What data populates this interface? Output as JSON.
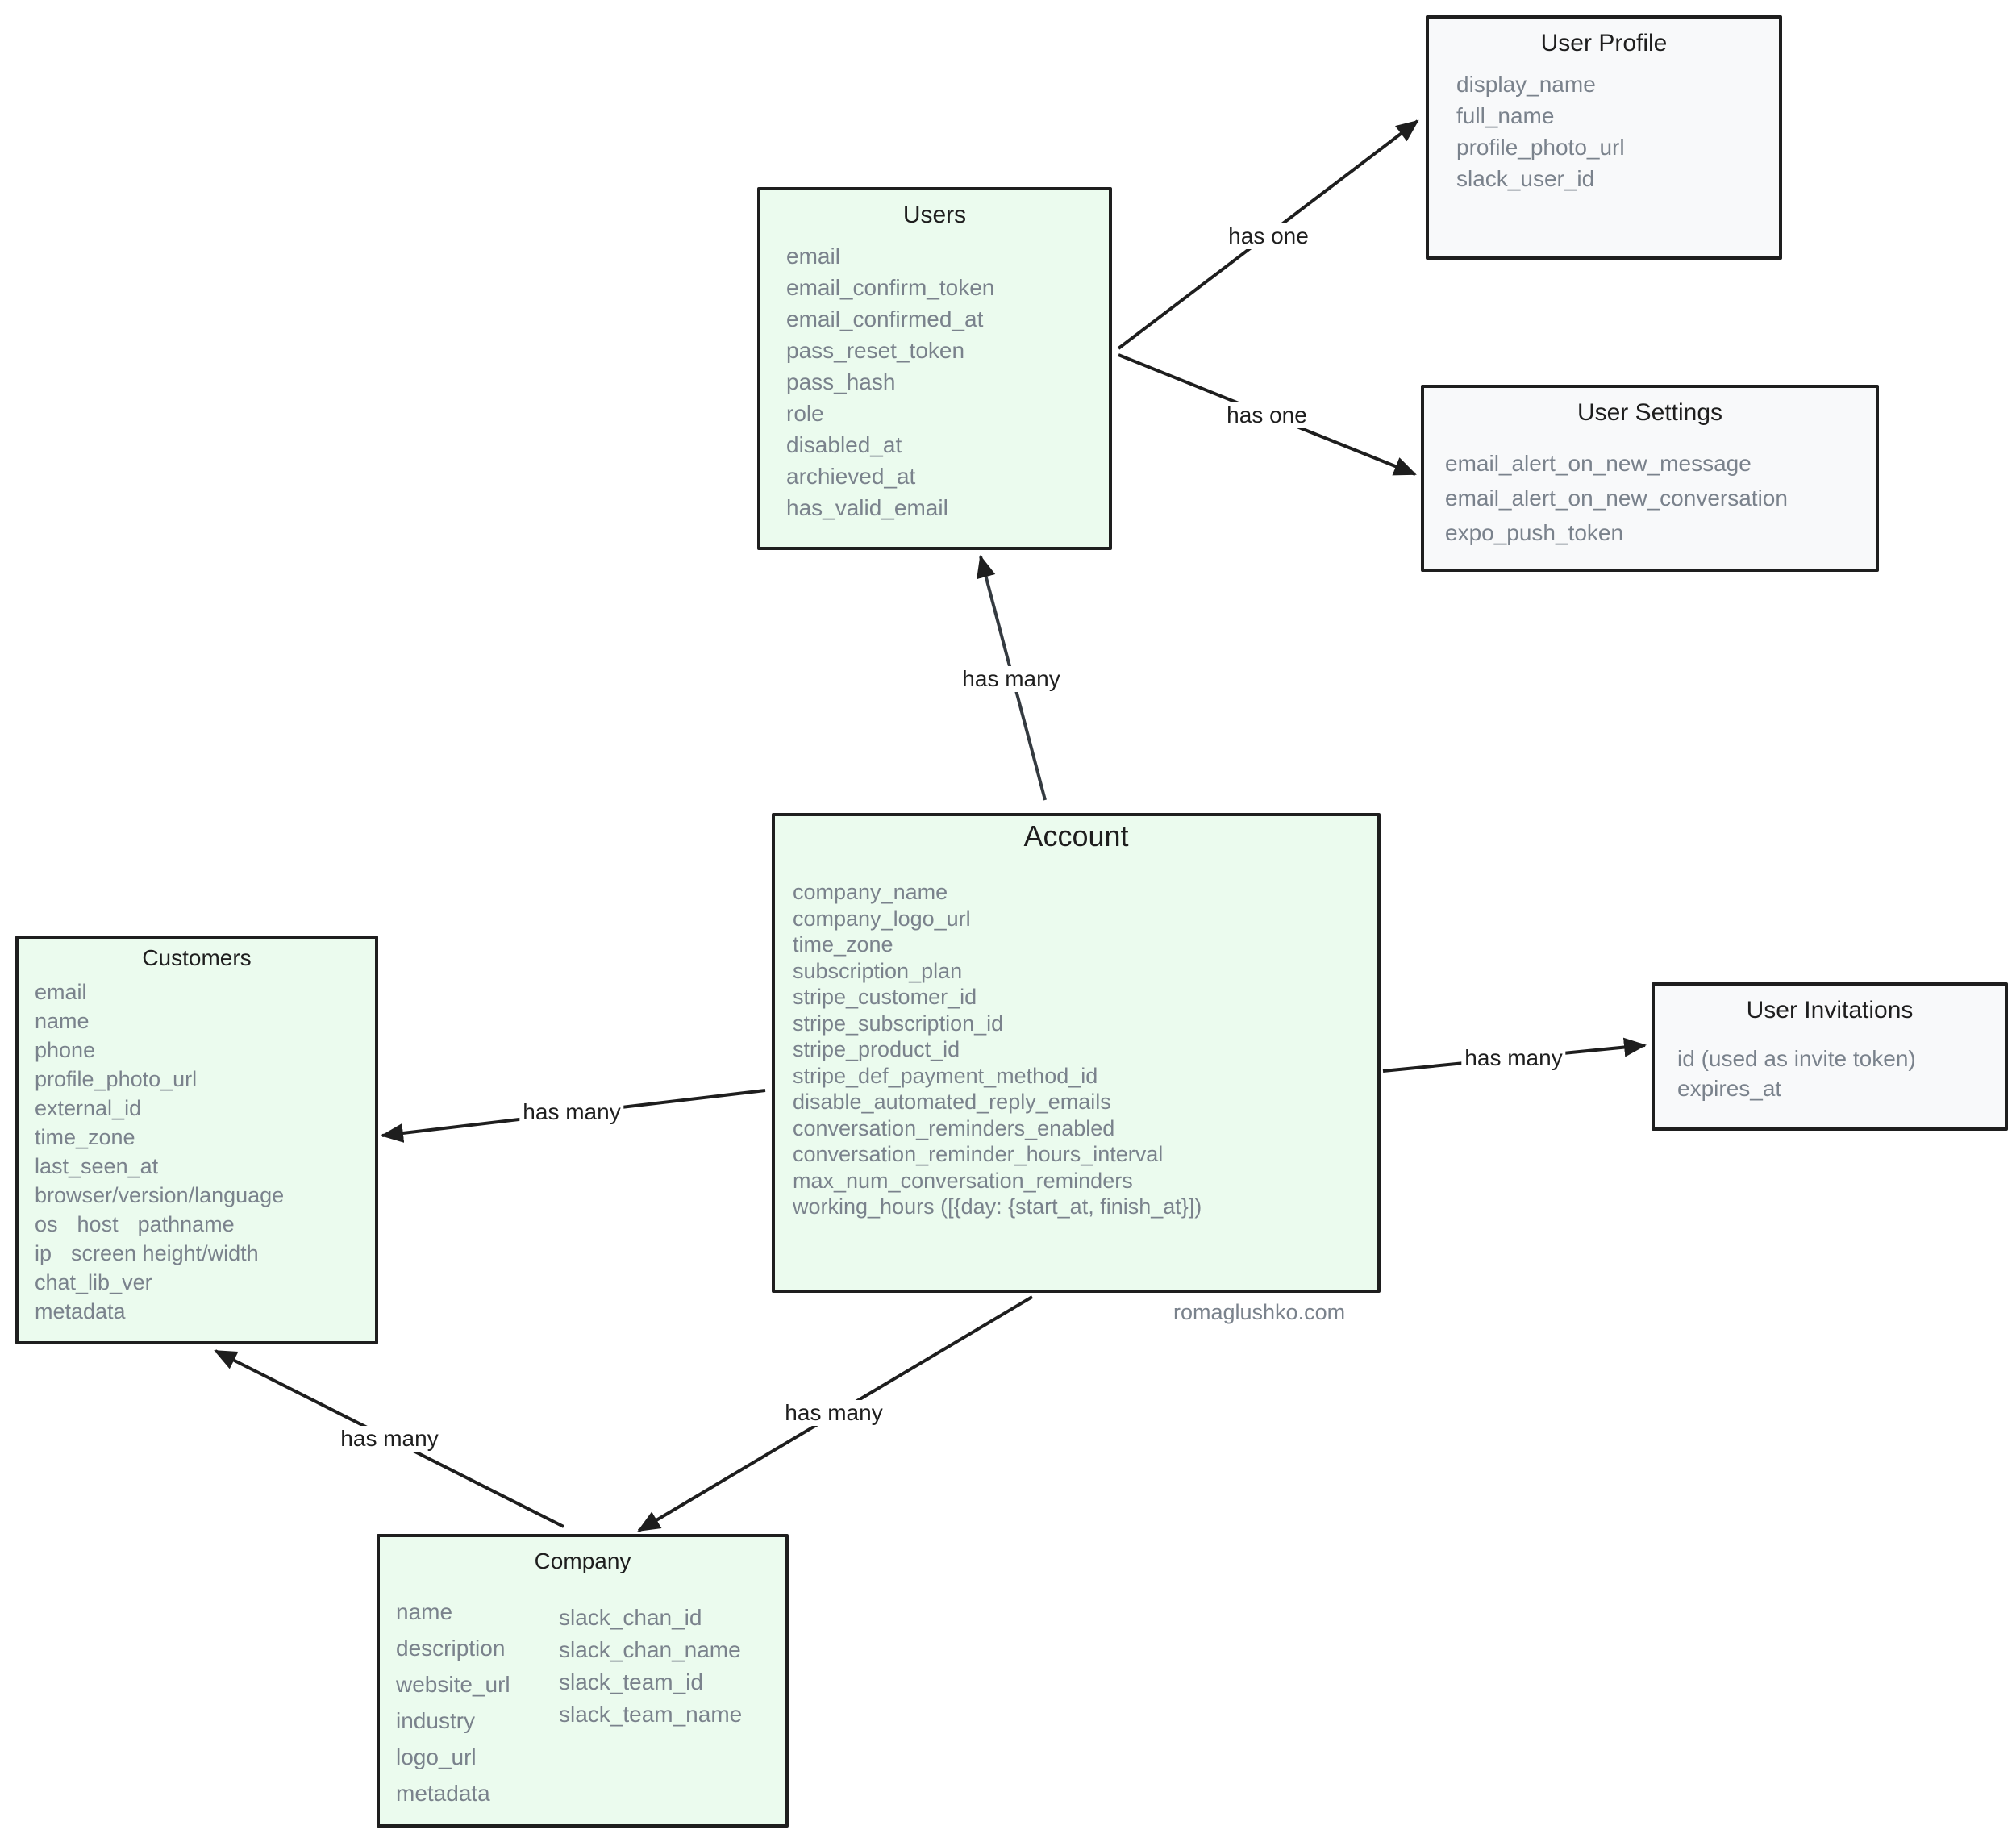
{
  "entities": {
    "users": {
      "title": "Users",
      "fields": [
        "email",
        "email_confirm_token",
        "email_confirmed_at",
        "pass_reset_token",
        "pass_hash",
        "role",
        "disabled_at",
        "archieved_at",
        "has_valid_email"
      ]
    },
    "user_profile": {
      "title": "User Profile",
      "fields": [
        "display_name",
        "full_name",
        "profile_photo_url",
        "slack_user_id"
      ]
    },
    "user_settings": {
      "title": "User Settings",
      "fields": [
        "email_alert_on_new_message",
        "email_alert_on_new_conversation",
        "expo_push_token"
      ]
    },
    "account": {
      "title": "Account",
      "fields": [
        "company_name",
        "company_logo_url",
        "time_zone",
        "subscription_plan",
        "stripe_customer_id",
        "stripe_subscription_id",
        "stripe_product_id",
        "stripe_def_payment_method_id",
        "disable_automated_reply_emails",
        "conversation_reminders_enabled",
        "conversation_reminder_hours_interval",
        "max_num_conversation_reminders",
        "working_hours ([{day: {start_at, finish_at}])"
      ]
    },
    "customers": {
      "title": "Customers",
      "rows": [
        [
          "email"
        ],
        [
          "name"
        ],
        [
          "phone"
        ],
        [
          "profile_photo_url"
        ],
        [
          "external_id"
        ],
        [
          "time_zone"
        ],
        [
          "last_seen_at"
        ],
        [
          "browser/version/language"
        ],
        [
          "os",
          "host",
          "pathname"
        ],
        [
          "ip",
          "screen height/width"
        ],
        [
          "chat_lib_ver"
        ],
        [
          "metadata"
        ]
      ]
    },
    "user_invitations": {
      "title": "User Invitations",
      "fields": [
        "id (used as invite token)",
        "expires_at"
      ]
    },
    "company": {
      "title": "Company",
      "left_fields": [
        "name",
        "description",
        "website_url",
        "industry",
        "logo_url",
        "metadata"
      ],
      "right_fields": [
        "slack_chan_id",
        "slack_chan_name",
        "slack_team_id",
        "slack_team_name"
      ]
    }
  },
  "relations": [
    {
      "from": "Users",
      "to": "User Profile",
      "label": "has one"
    },
    {
      "from": "Users",
      "to": "User Settings",
      "label": "has one"
    },
    {
      "from": "Account",
      "to": "Users",
      "label": "has many"
    },
    {
      "from": "Account",
      "to": "Customers",
      "label": "has many"
    },
    {
      "from": "Account",
      "to": "User Invitations",
      "label": "has many"
    },
    {
      "from": "Account",
      "to": "Company",
      "label": "has many"
    },
    {
      "from": "Company",
      "to": "Customers",
      "label": "has many"
    }
  ],
  "credit": "romaglushko.com",
  "colors": {
    "entity_fill": "#ebfbee",
    "secondary_fill": "#f8f9fa",
    "stroke": "#1e1e1e",
    "field_text": "#7a828c"
  }
}
